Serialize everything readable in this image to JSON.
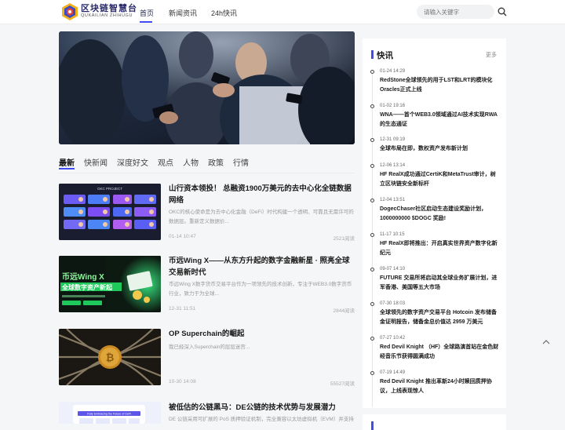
{
  "header": {
    "brand_cn": "区块链智慧台",
    "brand_en": "QUKAILIAN ZHIHUGU",
    "nav": [
      "首页",
      "新闻资讯",
      "24h快讯"
    ],
    "search_placeholder": "请输入关键字"
  },
  "tabs": [
    "最新",
    "快新闻",
    "深度好文",
    "观点",
    "人物",
    "政策",
    "行情"
  ],
  "articles": [
    {
      "title": "山行资本领投！ 总融资1900万美元的去中心化全链数据网络",
      "desc": "OKC的核心使命是为去中心化金融（DeFi）时代构建一个透明、可靠且无需许可的数据层。重新定义数据价...",
      "date": "01-14 10:47",
      "reads": "2521阅读",
      "thumb_label": "OKC PROJECT"
    },
    {
      "title": "币远Wing X——从东方升起的数字金融新星 · 照亮全球交易新时代",
      "desc": "币远Wing X数字货币交易平台作为一项领先的技术创新，专注于WEB3.0数字货币行业，致力于为全球...",
      "date": "12-31 11:51",
      "reads": "2844阅读",
      "thumb_label": "币远Wing X",
      "thumb_sub": "全球数字资产新起"
    },
    {
      "title": "OP Superchain的崛起",
      "desc": "我已经深入Superchain的层层迷宫...",
      "date": "10-30 14:08",
      "reads": "55527阅读"
    },
    {
      "title": "被低估的公链黑马：DE公链的技术优势与发展潜力",
      "desc": "DE 公链采用可扩展的 PoS 质押验证机制，完全兼容以太坊虚拟机（EVM）并支持",
      "thumb_label": "Fully Embracing the Future of DeFi"
    }
  ],
  "sidebar": {
    "title": "快讯",
    "more": "更多",
    "items": [
      {
        "time": "01-24 14:29",
        "title": "RedStone全球领先的用于LST和LRT的模块化Oracles正式上线"
      },
      {
        "time": "01-02 19:16",
        "title": "WNA——首个WEB3.0领域通过AI技术实现RWA的生态通证"
      },
      {
        "time": "12-31 09:19",
        "title": "全球布局在即，数权资产发布新计划"
      },
      {
        "time": "12-06 13:14",
        "title": "HF RealX成功通过CertiK和MetaTrust审计，树立区块链安全新标杆"
      },
      {
        "time": "12-04 13:51",
        "title": "DogecChaser社区启动生态建设奖励计划，1000000000 $DOGC 奖励!"
      },
      {
        "time": "11-17 10:15",
        "title": "HF RealX即将推出：开启真实世界资产数字化新纪元"
      },
      {
        "time": "09-07 14:10",
        "title": "FUTURE 交易所将启动其全球业务扩展计划，进军香港、美国等五大市场"
      },
      {
        "time": "07-30 18:03",
        "title": "全球领先的数字资产交易平台 Hotcoin 发布储备金证明报告，储备金总价值达 2959 万美元"
      },
      {
        "time": "07-27 10:42",
        "title": "Red Devil Knight （HF）全球路演首站在金色财经音乐节获得圆满成功"
      },
      {
        "time": "07-19 14:49",
        "title": "Red Devil Knight 推出革新24小时赎回质押协议，上线表现惊人"
      }
    ]
  },
  "colors": {
    "accent": "#3e4cf0",
    "text": "#1a1a1a",
    "muted": "#9a9a9a",
    "background": "#f5f6f8"
  }
}
